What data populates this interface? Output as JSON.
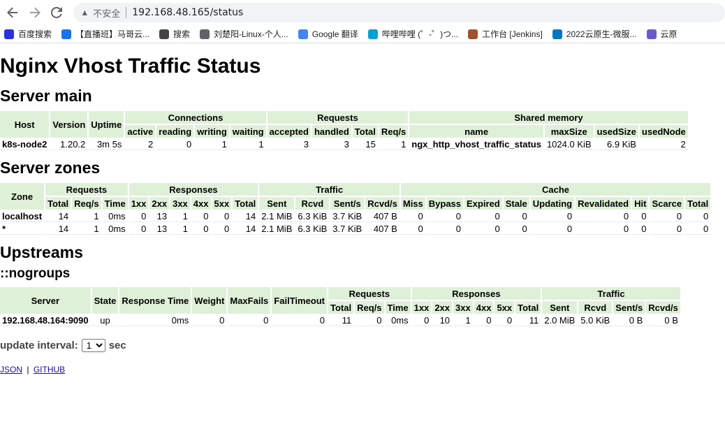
{
  "browser": {
    "insecure_label": "不安全",
    "url": "192.168.48.165/status",
    "bookmarks": [
      {
        "label": "百度搜索",
        "icon": "paw-icon",
        "color": "#2932e1"
      },
      {
        "label": "【直播班】马哥云...",
        "icon": "diamond-icon",
        "color": "#1a73e8"
      },
      {
        "label": "搜索",
        "icon": "search-icon",
        "color": "#444444"
      },
      {
        "label": "刘楚阳-Linux-个人...",
        "icon": "globe-icon",
        "color": "#5f6368"
      },
      {
        "label": "Google 翻译",
        "icon": "translate-icon",
        "color": "#4285f4"
      },
      {
        "label": "哔哩哔哩 (゜-゜)つ...",
        "icon": "bilibili-icon",
        "color": "#00a1d6"
      },
      {
        "label": "工作台 [Jenkins]",
        "icon": "jenkins-icon",
        "color": "#a0522d"
      },
      {
        "label": "2022云原生-微服...",
        "icon": "u-icon",
        "color": "#0077c2"
      },
      {
        "label": "云原",
        "icon": "flower-icon",
        "color": "#6a5acd"
      }
    ]
  },
  "page": {
    "title": "Nginx Vhost Traffic Status",
    "server_main": {
      "heading": "Server main",
      "groups": {
        "connections": "Connections",
        "requests": "Requests",
        "shared_memory": "Shared memory"
      },
      "headers": [
        "Host",
        "Version",
        "Uptime",
        "active",
        "reading",
        "writing",
        "waiting",
        "accepted",
        "handled",
        "Total",
        "Req/s",
        "name",
        "maxSize",
        "usedSize",
        "usedNode"
      ],
      "row": [
        "k8s-node2",
        "1.20.2",
        "3m 5s",
        "2",
        "0",
        "1",
        "1",
        "3",
        "3",
        "15",
        "1",
        "ngx_http_vhost_traffic_status",
        "1024.0 KiB",
        "6.9 KiB",
        "2"
      ]
    },
    "server_zones": {
      "heading": "Server zones",
      "groups": {
        "zone": "Zone",
        "requests": "Requests",
        "responses": "Responses",
        "traffic": "Traffic",
        "cache": "Cache"
      },
      "headers": [
        "Total",
        "Req/s",
        "Time",
        "1xx",
        "2xx",
        "3xx",
        "4xx",
        "5xx",
        "Total",
        "Sent",
        "Rcvd",
        "Sent/s",
        "Rcvd/s",
        "Miss",
        "Bypass",
        "Expired",
        "Stale",
        "Updating",
        "Revalidated",
        "Hit",
        "Scarce",
        "Total"
      ],
      "rows": [
        [
          "localhost",
          "14",
          "1",
          "0ms",
          "0",
          "13",
          "1",
          "0",
          "0",
          "14",
          "2.1 MiB",
          "6.3 KiB",
          "3.7 KiB",
          "407 B",
          "0",
          "0",
          "0",
          "0",
          "0",
          "0",
          "0",
          "0",
          "0"
        ],
        [
          "*",
          "14",
          "1",
          "0ms",
          "0",
          "13",
          "1",
          "0",
          "0",
          "14",
          "2.1 MiB",
          "6.3 KiB",
          "3.7 KiB",
          "407 B",
          "0",
          "0",
          "0",
          "0",
          "0",
          "0",
          "0",
          "0",
          "0"
        ]
      ]
    },
    "upstreams": {
      "heading": "Upstreams",
      "group_name": "::nogroups",
      "groups": {
        "server": "Server",
        "state": "State",
        "response_time": "Response Time",
        "weight": "Weight",
        "max_fails": "MaxFails",
        "fail_timeout": "FailTimeout",
        "requests": "Requests",
        "responses": "Responses",
        "traffic": "Traffic"
      },
      "headers": [
        "Total",
        "Req/s",
        "Time",
        "1xx",
        "2xx",
        "3xx",
        "4xx",
        "5xx",
        "Total",
        "Sent",
        "Rcvd",
        "Sent/s",
        "Rcvd/s"
      ],
      "row": [
        "192.168.48.164:9090",
        "up",
        "0ms",
        "0",
        "0",
        "0",
        "11",
        "0",
        "0ms",
        "0",
        "10",
        "1",
        "0",
        "0",
        "11",
        "2.0 MiB",
        "5.0 KiB",
        "0 B",
        "0 B"
      ]
    },
    "update_interval": {
      "label": "update interval:",
      "value": "1",
      "unit": "sec"
    },
    "links": {
      "json": "JSON",
      "github": "GITHUB",
      "separator": "|"
    }
  }
}
